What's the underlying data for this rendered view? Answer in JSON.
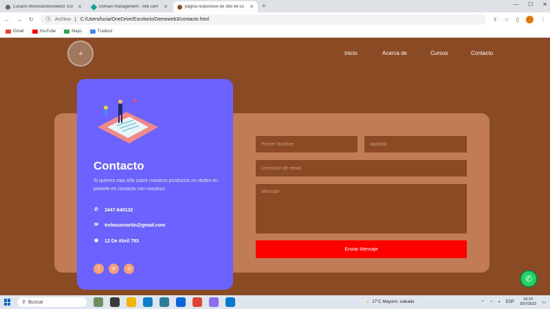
{
  "browser": {
    "tabs": [
      {
        "title": "Luciano Moreira/Demoweb3: Est",
        "active": false
      },
      {
        "title": "Domain management - Site conf",
        "active": false
      },
      {
        "title": "página responsive de sitio de co",
        "active": true
      }
    ],
    "address": {
      "scheme": "Archivo",
      "path": "C:/Users/lucia/OneDrive/Escritorio/Demoweb3/contacto.html"
    },
    "bookmarks": [
      "Gmail",
      "YouTube",
      "Maps",
      "Traducir"
    ]
  },
  "site": {
    "nav": [
      "Inicio",
      "Acerca de",
      "Cursos",
      "Contacto"
    ],
    "card": {
      "title": "Contacto",
      "description": "Si quieres más info sobre nuestros productos no dudes en ponerte en contacto con nosotros",
      "phone": "3447-640132",
      "email": "trebouxmartin@gmail.com",
      "address": "12 De Abril 783"
    },
    "form": {
      "first_name_placeholder": "Primer Nombre",
      "last_name_placeholder": "Apellido",
      "email_placeholder": "Dirección de email",
      "message_placeholder": "Mensaje",
      "submit_label": "Enviar Mensaje"
    }
  },
  "taskbar": {
    "search_placeholder": "Buscar",
    "weather": "17°C Mayorm. soleado",
    "lang": "ESP",
    "time": "16:10",
    "date": "20/7/2023"
  },
  "colors": {
    "page_bg": "#8a4a24",
    "form_panel": "#c17c57",
    "card": "#6c63ff",
    "submit": "#ff0000",
    "whatsapp": "#25d366"
  },
  "icons": [
    "phone-icon",
    "mail-icon",
    "location-icon",
    "facebook-icon",
    "instagram-icon",
    "whatsapp-icon"
  ]
}
